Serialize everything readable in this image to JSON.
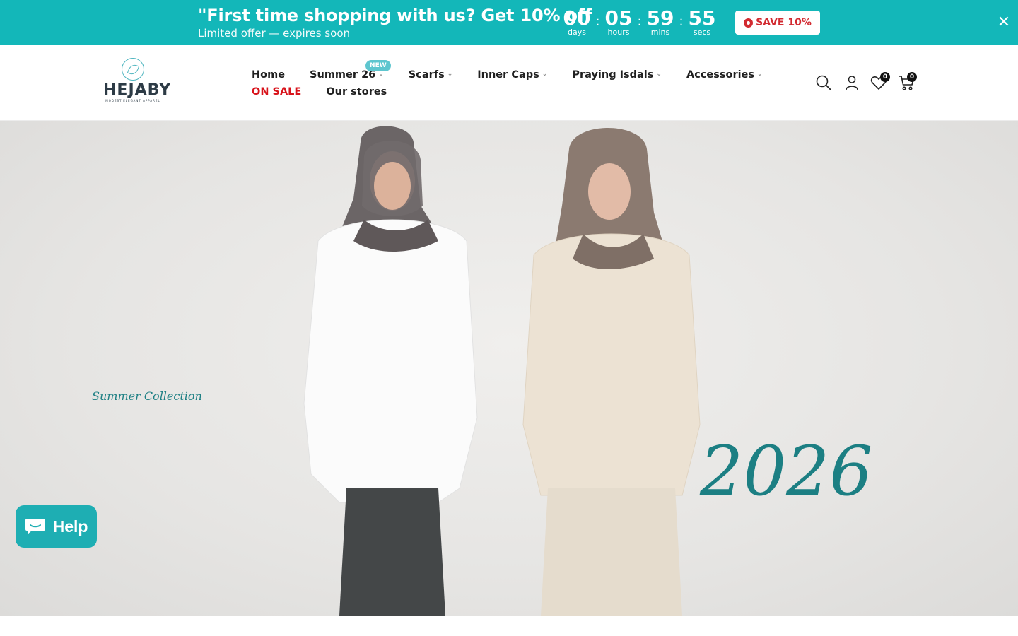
{
  "promo": {
    "title": "\"First time shopping with us? Get 10% off",
    "subtitle": "Limited offer — expires soon",
    "countdown": {
      "days": "00",
      "days_label": "days",
      "hours": "05",
      "hours_label": "hours",
      "mins": "59",
      "mins_label": "mins",
      "secs": "55",
      "secs_label": "secs",
      "sep": ":"
    },
    "save_label": "SAVE 10%",
    "close_glyph": "✕"
  },
  "header": {
    "logo": {
      "name": "HEJABY",
      "tagline": "MODEST.ELEGANT APPAREL"
    },
    "nav": [
      {
        "label": "Home"
      },
      {
        "label": "Summer 26",
        "badge": "NEW"
      },
      {
        "label": "Scarfs"
      },
      {
        "label": "Inner Caps"
      },
      {
        "label": "Praying Isdals"
      },
      {
        "label": "Accessories"
      },
      {
        "label": "ON SALE"
      },
      {
        "label": "Our stores"
      }
    ],
    "chev": "⌄",
    "wishlist_count": "0",
    "cart_count": "0",
    "icons": [
      "search-icon",
      "account-icon",
      "heart-icon",
      "cart-icon"
    ]
  },
  "hero": {
    "title": "Summer Collection",
    "year": "2026"
  },
  "chat": {
    "label": "Help"
  },
  "colors": {
    "accent": "#13b7b9",
    "sale": "#d8131b",
    "hero_text": "#1c7f83"
  }
}
